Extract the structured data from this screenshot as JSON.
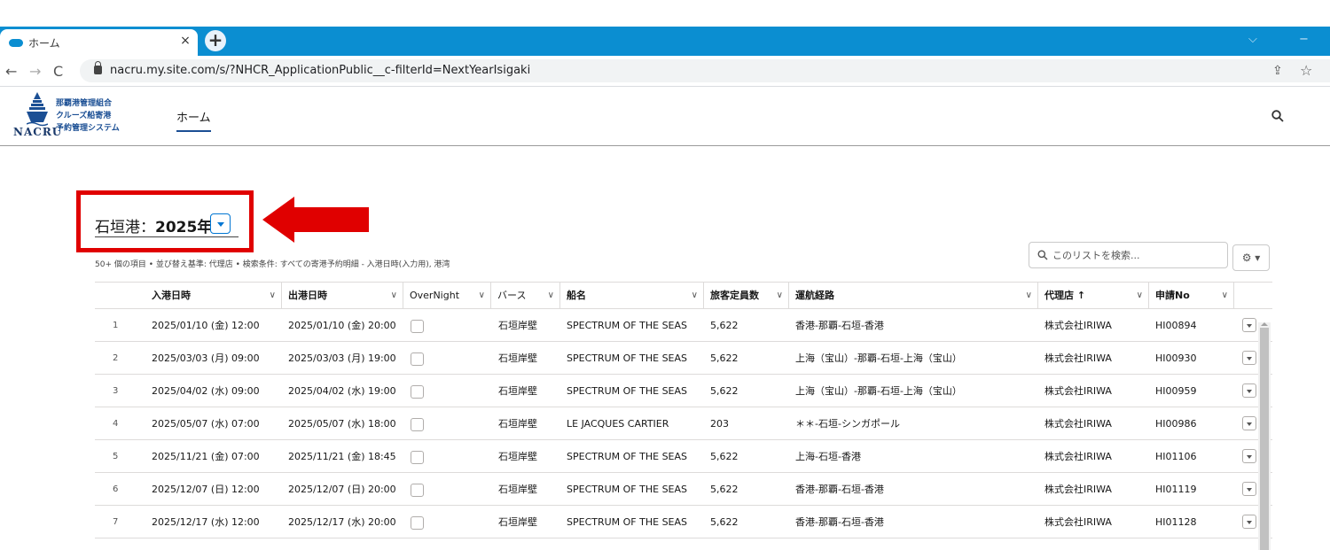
{
  "browser": {
    "tab_title": "ホーム",
    "tab_close": "×",
    "new_tab": "+",
    "url": "nacru.my.site.com/s/?NHCR_ApplicationPublic__c-filterId=NextYearIsigaki",
    "minimize": "−",
    "chevron": "⌵"
  },
  "site": {
    "logo_name": "NACRU",
    "logo_line1": "那覇港管理組合",
    "logo_line2": "クルーズ船寄港",
    "logo_line3": "予約管理システム",
    "nav_home": "ホーム"
  },
  "list": {
    "title_prefix": "石垣港：",
    "title_year": "2025年",
    "meta": "50+ 個の項目 • 並び替え基準: 代理店 • 検索条件: すべての寄港予約明細 - 入港日時(入力用), 港湾",
    "search_placeholder": "このリストを検索...",
    "gear_label": "⚙ ▾"
  },
  "table": {
    "columns": [
      {
        "label": "入港日時",
        "chevron": "∨"
      },
      {
        "label": "出港日時",
        "chevron": "∨"
      },
      {
        "label": "OverNight",
        "chevron": "∨"
      },
      {
        "label": "バース",
        "chevron": "∨"
      },
      {
        "label": "船名",
        "chevron": "∨"
      },
      {
        "label": "旅客定員数",
        "chevron": "∨"
      },
      {
        "label": "運航経路",
        "chevron": "∨"
      },
      {
        "label": "代理店 ↑",
        "chevron": "∨"
      },
      {
        "label": "申請No",
        "chevron": "∨"
      }
    ],
    "rows": [
      {
        "num": "1",
        "arrival": "2025/01/10 (金) 12:00",
        "departure": "2025/01/10 (金) 20:00",
        "berth": "石垣岸壁",
        "ship": "SPECTRUM OF THE SEAS",
        "capacity": "5,622",
        "route": "香港-那覇-石垣-香港",
        "agent": "株式会社IRIWA",
        "app_no": "HI00894"
      },
      {
        "num": "2",
        "arrival": "2025/03/03 (月) 09:00",
        "departure": "2025/03/03 (月) 19:00",
        "berth": "石垣岸壁",
        "ship": "SPECTRUM OF THE SEAS",
        "capacity": "5,622",
        "route": "上海（宝山）-那覇-石垣-上海（宝山）",
        "agent": "株式会社IRIWA",
        "app_no": "HI00930"
      },
      {
        "num": "3",
        "arrival": "2025/04/02 (水) 09:00",
        "departure": "2025/04/02 (水) 19:00",
        "berth": "石垣岸壁",
        "ship": "SPECTRUM OF THE SEAS",
        "capacity": "5,622",
        "route": "上海（宝山）-那覇-石垣-上海（宝山）",
        "agent": "株式会社IRIWA",
        "app_no": "HI00959"
      },
      {
        "num": "4",
        "arrival": "2025/05/07 (水) 07:00",
        "departure": "2025/05/07 (水) 18:00",
        "berth": "石垣岸壁",
        "ship": "LE JACQUES CARTIER",
        "capacity": "203",
        "route": "＊＊-石垣-シンガポール",
        "agent": "株式会社IRIWA",
        "app_no": "HI00986"
      },
      {
        "num": "5",
        "arrival": "2025/11/21 (金) 07:00",
        "departure": "2025/11/21 (金) 18:45",
        "berth": "石垣岸壁",
        "ship": "SPECTRUM OF THE SEAS",
        "capacity": "5,622",
        "route": "上海-石垣-香港",
        "agent": "株式会社IRIWA",
        "app_no": "HI01106"
      },
      {
        "num": "6",
        "arrival": "2025/12/07 (日) 12:00",
        "departure": "2025/12/07 (日) 20:00",
        "berth": "石垣岸壁",
        "ship": "SPECTRUM OF THE SEAS",
        "capacity": "5,622",
        "route": "香港-那覇-石垣-香港",
        "agent": "株式会社IRIWA",
        "app_no": "HI01119"
      },
      {
        "num": "7",
        "arrival": "2025/12/17 (水) 12:00",
        "departure": "2025/12/17 (水) 20:00",
        "berth": "石垣岸壁",
        "ship": "SPECTRUM OF THE SEAS",
        "capacity": "5,622",
        "route": "香港-那覇-石垣-香港",
        "agent": "株式会社IRIWA",
        "app_no": "HI01128"
      }
    ]
  },
  "colors": {
    "tabbar": "#0b8ed1",
    "highlight_red": "#e00000",
    "accent_blue": "#0176d3"
  }
}
